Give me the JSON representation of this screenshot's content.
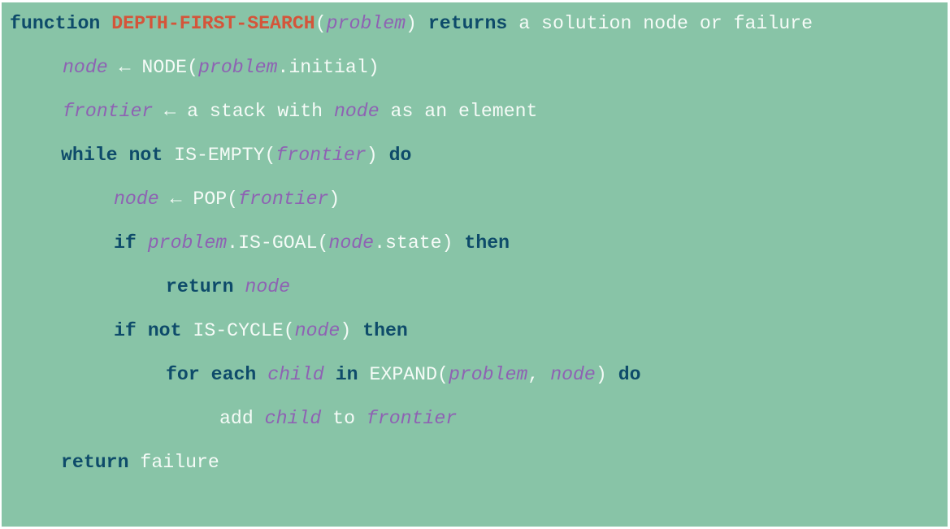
{
  "colors": {
    "background": "#88c4a7",
    "keyword": "#0e4b6a",
    "function_name": "#d4553a",
    "variable": "#8e62b3",
    "plain_text": "#f5fbf7"
  },
  "lines": [
    {
      "tokens": [
        {
          "t": "kw",
          "v": "function"
        },
        {
          "t": "sp",
          "v": " "
        },
        {
          "t": "fn",
          "v": "DEPTH-FIRST-SEARCH"
        },
        {
          "t": "plain",
          "v": "("
        },
        {
          "t": "var",
          "v": "problem"
        },
        {
          "t": "plain",
          "v": ")"
        },
        {
          "t": "sp",
          "v": " "
        },
        {
          "t": "kw",
          "v": "returns"
        },
        {
          "t": "plain",
          "v": " a solution node or failure"
        }
      ]
    },
    {
      "tokens": [
        {
          "t": "var",
          "v": "node"
        },
        {
          "t": "plain",
          "v": " ← NODE("
        },
        {
          "t": "var",
          "v": "problem"
        },
        {
          "t": "plain",
          "v": ".initial)"
        }
      ]
    },
    {
      "tokens": [
        {
          "t": "var",
          "v": "frontier"
        },
        {
          "t": "plain",
          "v": " ← a stack with "
        },
        {
          "t": "var",
          "v": "node"
        },
        {
          "t": "plain",
          "v": " as an element"
        }
      ]
    },
    {
      "tokens": [
        {
          "t": "kw",
          "v": "while"
        },
        {
          "t": "sp",
          "v": " "
        },
        {
          "t": "kw",
          "v": "not"
        },
        {
          "t": "plain",
          "v": " IS-EMPTY("
        },
        {
          "t": "var",
          "v": "frontier"
        },
        {
          "t": "plain",
          "v": ")"
        },
        {
          "t": "sp",
          "v": " "
        },
        {
          "t": "kw",
          "v": "do"
        }
      ]
    },
    {
      "tokens": [
        {
          "t": "var",
          "v": "node"
        },
        {
          "t": "plain",
          "v": " ← POP("
        },
        {
          "t": "var",
          "v": "frontier"
        },
        {
          "t": "plain",
          "v": ")"
        }
      ]
    },
    {
      "tokens": [
        {
          "t": "kw",
          "v": "if"
        },
        {
          "t": "sp",
          "v": " "
        },
        {
          "t": "var",
          "v": "problem"
        },
        {
          "t": "plain",
          "v": ".IS-GOAL("
        },
        {
          "t": "var",
          "v": "node"
        },
        {
          "t": "plain",
          "v": ".state)"
        },
        {
          "t": "sp",
          "v": " "
        },
        {
          "t": "kw",
          "v": "then"
        }
      ]
    },
    {
      "tokens": [
        {
          "t": "kw",
          "v": "return"
        },
        {
          "t": "sp",
          "v": " "
        },
        {
          "t": "var",
          "v": "node"
        }
      ]
    },
    {
      "tokens": [
        {
          "t": "kw",
          "v": "if"
        },
        {
          "t": "sp",
          "v": " "
        },
        {
          "t": "kw",
          "v": "not"
        },
        {
          "t": "plain",
          "v": " IS-CYCLE("
        },
        {
          "t": "var",
          "v": "node"
        },
        {
          "t": "plain",
          "v": ")"
        },
        {
          "t": "sp",
          "v": " "
        },
        {
          "t": "kw",
          "v": "then"
        }
      ]
    },
    {
      "tokens": [
        {
          "t": "kw",
          "v": "for"
        },
        {
          "t": "sp",
          "v": " "
        },
        {
          "t": "kw",
          "v": "each"
        },
        {
          "t": "sp",
          "v": " "
        },
        {
          "t": "var",
          "v": "child"
        },
        {
          "t": "sp",
          "v": " "
        },
        {
          "t": "kw",
          "v": "in"
        },
        {
          "t": "plain",
          "v": " EXPAND("
        },
        {
          "t": "var",
          "v": "problem"
        },
        {
          "t": "plain",
          "v": ", "
        },
        {
          "t": "var",
          "v": "node"
        },
        {
          "t": "plain",
          "v": ")"
        },
        {
          "t": "sp",
          "v": " "
        },
        {
          "t": "kw",
          "v": "do"
        }
      ]
    },
    {
      "tokens": [
        {
          "t": "plain",
          "v": "add "
        },
        {
          "t": "var",
          "v": "child"
        },
        {
          "t": "plain",
          "v": " to "
        },
        {
          "t": "var",
          "v": "frontier"
        }
      ]
    },
    {
      "tokens": [
        {
          "t": "kw",
          "v": "return"
        },
        {
          "t": "plain",
          "v": " failure"
        }
      ]
    }
  ]
}
